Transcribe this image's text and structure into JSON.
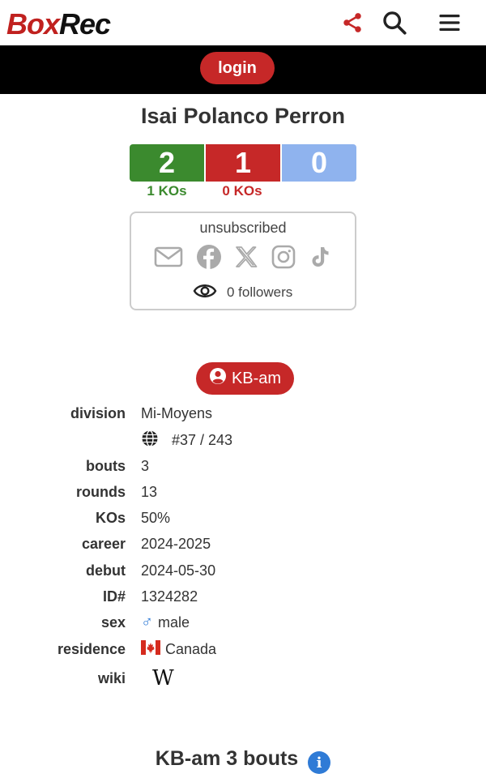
{
  "header": {
    "logo_part1": "Box",
    "logo_part2": "Rec",
    "icons": [
      "share-icon",
      "search-icon",
      "menu-icon"
    ]
  },
  "login": {
    "label": "login"
  },
  "boxer": {
    "name": "Isai Polanco Perron"
  },
  "record": {
    "wins": "2",
    "losses": "1",
    "draws": "0",
    "wins_kos": "1 KOs",
    "losses_kos": "0 KOs"
  },
  "social": {
    "status": "unsubscribed",
    "icons": [
      "email-icon",
      "facebook-icon",
      "x-icon",
      "instagram-icon",
      "tiktok-icon"
    ],
    "followers": "0 followers"
  },
  "promo": {
    "label": "KB-am"
  },
  "details": {
    "division": {
      "label": "division",
      "value": "Mi-Moyens"
    },
    "ranking": {
      "value": "#37 / 243"
    },
    "bouts": {
      "label": "bouts",
      "value": "3"
    },
    "rounds": {
      "label": "rounds",
      "value": "13"
    },
    "kos": {
      "label": "KOs",
      "value": "50%"
    },
    "career": {
      "label": "career",
      "value": "2024-2025"
    },
    "debut": {
      "label": "debut",
      "value": "2024-05-30"
    },
    "id": {
      "label": "ID#",
      "value": "1324282"
    },
    "sex": {
      "label": "sex",
      "symbol": "♂",
      "value": "male"
    },
    "residence": {
      "label": "residence",
      "value": "Canada"
    },
    "wiki": {
      "label": "wiki",
      "symbol": "W"
    }
  },
  "section": {
    "title": "KB-am 3 bouts",
    "info_symbol": "i"
  },
  "colors": {
    "brand_red": "#c62828",
    "win_green": "#3b8a2e",
    "draw_blue": "#8fb3ee",
    "info_blue": "#2f7bd6"
  }
}
